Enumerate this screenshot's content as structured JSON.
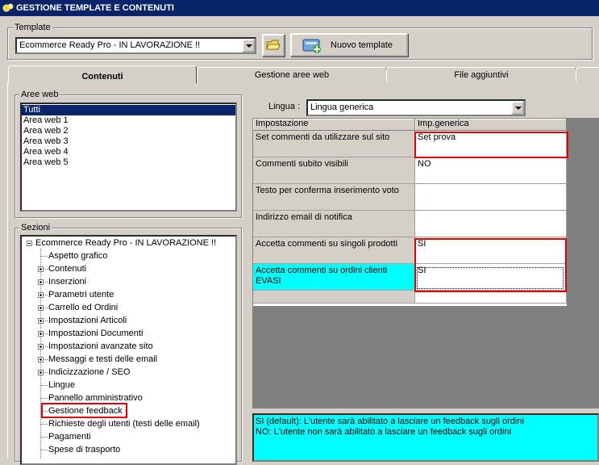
{
  "window": {
    "title": "GESTIONE TEMPLATE E CONTENUTI"
  },
  "template": {
    "label": "Template",
    "selected": "Ecommerce Ready Pro - IN LAVORAZIONE !!",
    "new_button": "Nuovo template"
  },
  "tabs": [
    "Contenuti",
    "Gestione aree web",
    "File aggiuntivi"
  ],
  "aree_web": {
    "label": "Aree web",
    "items": [
      "Tutti",
      "Area web 1",
      "Area web 2",
      "Area web 3",
      "Area web 4",
      "Area web 5"
    ]
  },
  "sezioni": {
    "label": "Sezioni",
    "root": "Ecommerce Ready Pro - IN LAVORAZIONE !!",
    "items": [
      {
        "label": "Aspetto grafico",
        "expandable": false
      },
      {
        "label": "Contenuti",
        "expandable": true
      },
      {
        "label": "Inserzioni",
        "expandable": true
      },
      {
        "label": "Parametri utente",
        "expandable": true
      },
      {
        "label": "Carrello ed Ordini",
        "expandable": true
      },
      {
        "label": "Impostazioni Articoli",
        "expandable": true
      },
      {
        "label": "Impostazioni Documenti",
        "expandable": true
      },
      {
        "label": "Impostazioni avanzate sito",
        "expandable": true
      },
      {
        "label": "Messaggi e testi delle email",
        "expandable": true
      },
      {
        "label": "Indicizzazione / SEO",
        "expandable": true
      },
      {
        "label": "Lingue",
        "expandable": false
      },
      {
        "label": "Pannello amministrativo",
        "expandable": false
      },
      {
        "label": "Gestione feedback",
        "expandable": false
      },
      {
        "label": "Richieste degli utenti (testi delle email)",
        "expandable": false
      },
      {
        "label": "Pagamenti",
        "expandable": false
      },
      {
        "label": "Spese di trasporto",
        "expandable": false
      }
    ]
  },
  "lingua": {
    "label": "Lingua :",
    "selected": "Lingua generica"
  },
  "grid": {
    "headers": [
      "Impostazione",
      "Imp.generica"
    ],
    "rows": [
      {
        "name": "Set commenti da utilizzare sul sito",
        "value": "Set prova"
      },
      {
        "name": "Commenti subito visibili",
        "value": "NO"
      },
      {
        "name": "Testo per conferma inserimento voto",
        "value": ""
      },
      {
        "name": "Indirizzo email di notifica",
        "value": ""
      },
      {
        "name": "Accetta commenti su singoli prodotti",
        "value": "SI"
      },
      {
        "name": "Accetta commenti su ordini clienti EVASI",
        "value": "SI"
      }
    ]
  },
  "description": {
    "line1": "SI (default): L'utente sarà abilitato a lasciare un feedback sugli ordini",
    "line2": "NO: L'utente non sarà abilitato a lasciare un feedback sugli ordini"
  }
}
